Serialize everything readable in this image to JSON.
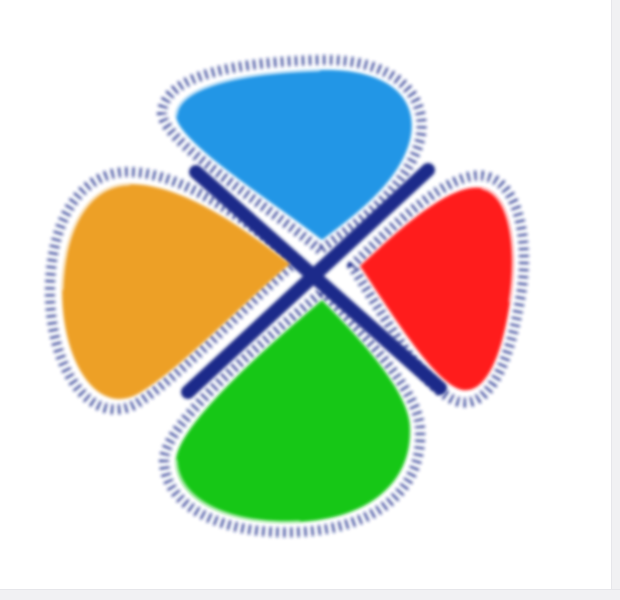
{
  "app_icon": {
    "icon_name": "pinwheel-logo-icon",
    "colors": {
      "blue_petal": "#2196e6",
      "red_petal": "#ff1e1e",
      "green_petal": "#16c716",
      "orange_petal": "#eda026",
      "cross_outline": "#1f2a8a",
      "background": "#ffffff",
      "edge": "#f1f1f3"
    }
  }
}
